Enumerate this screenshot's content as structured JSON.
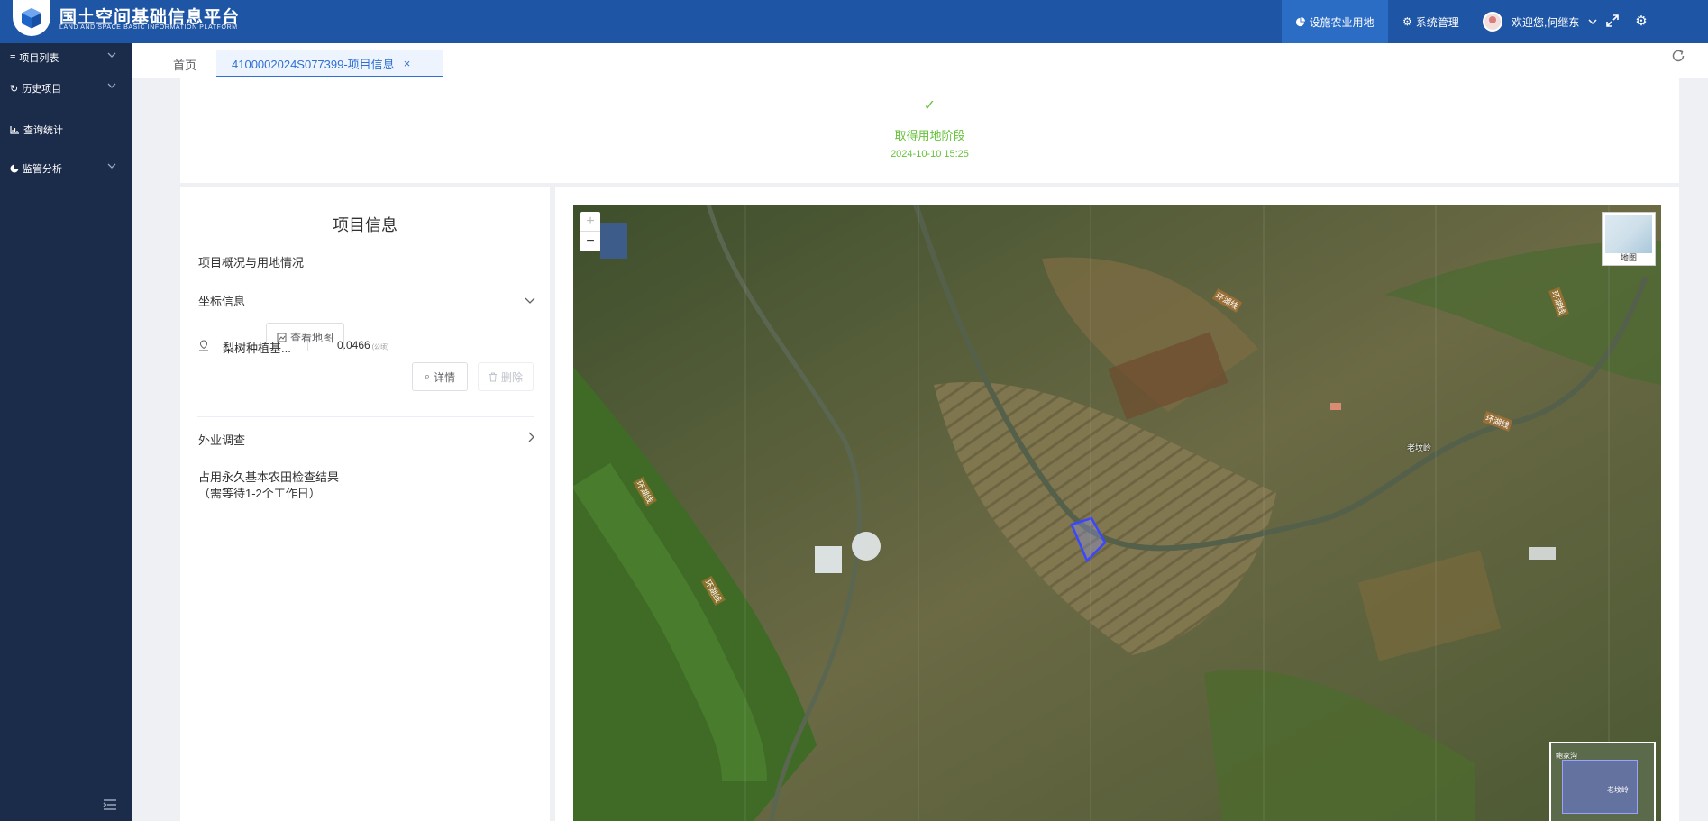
{
  "header": {
    "brand_title": "国土空间基础信息平台",
    "brand_subtitle": "LAND AND SPACE BASIC INFORMATION PLATFORM",
    "nav_active": "设施农业用地",
    "nav_system": "系统管理",
    "user_greeting": "欢迎您,何继东",
    "icons": [
      "pie-icon",
      "gears-icon",
      "chevron-down-icon",
      "expand-icon",
      "settings-icon"
    ]
  },
  "sidebar": {
    "items": [
      {
        "label": "项目列表",
        "icon": "list-icon",
        "has_submenu": true
      },
      {
        "label": "历史项目",
        "icon": "history-icon",
        "has_submenu": true
      },
      {
        "label": "查询统计",
        "icon": "bar-chart-icon",
        "has_submenu": false
      },
      {
        "label": "监管分析",
        "icon": "pie-chart-icon",
        "has_submenu": true
      }
    ]
  },
  "tabs": {
    "home": "首页",
    "active": "4100002024S077399-项目信息",
    "close": "×"
  },
  "status": {
    "check": "✓",
    "stage": "取得用地阶段",
    "time": "2024-10-10 15:25"
  },
  "panel": {
    "title": "项目信息",
    "overview": "项目概况与用地情况",
    "coords": "坐标信息",
    "view_map": "查看地图",
    "parcel": {
      "name": "梨树种植基...",
      "area": "0.0466",
      "unit": "(公顷)",
      "detail": "详情",
      "delete": "删除"
    },
    "field_survey": "外业调查",
    "farmland_check_line1": "占用永久基本农田检查结果",
    "farmland_check_line2": "（需等待1-2个工作日）"
  },
  "map": {
    "zoom_in": "+",
    "zoom_out": "−",
    "layer_label": "地图",
    "road_labels": [
      "环湖线",
      "环湖线",
      "环湖线",
      "环湖线",
      "环湖线"
    ],
    "place_labels": [
      "老坟岭"
    ],
    "overview_labels": [
      "鲍家沟",
      "老坟岭"
    ]
  },
  "colors": {
    "header": "#1e55a5",
    "sidebar": "#1b2b4a",
    "accent": "#2f6fd3",
    "success": "#67c23a"
  }
}
